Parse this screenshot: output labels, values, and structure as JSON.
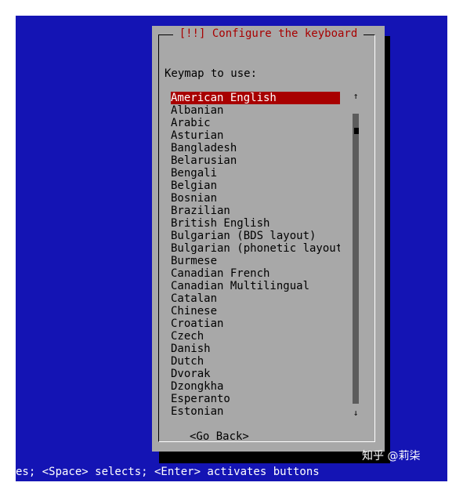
{
  "dialog": {
    "title": "[!!] Configure the keyboard",
    "prompt": "Keymap to use:",
    "selected_index": 0,
    "keymaps": [
      "American English",
      "Albanian",
      "Arabic",
      "Asturian",
      "Bangladesh",
      "Belarusian",
      "Bengali",
      "Belgian",
      "Bosnian",
      "Brazilian",
      "British English",
      "Bulgarian (BDS layout)",
      "Bulgarian (phonetic layout)",
      "Burmese",
      "Canadian French",
      "Canadian Multilingual",
      "Catalan",
      "Chinese",
      "Croatian",
      "Czech",
      "Danish",
      "Dutch",
      "Dvorak",
      "Dzongkha",
      "Esperanto",
      "Estonian"
    ],
    "scroll_up_symbol": "↑",
    "scroll_down_symbol": "↓",
    "go_back_label": "<Go Back>"
  },
  "status_bar": {
    "text": "es; <Space> selects; <Enter> activates buttons"
  },
  "watermark": {
    "text": "知乎 @莉柒"
  },
  "colors": {
    "screen_background": "#1414b4",
    "dialog_background": "#a8a8a8",
    "accent": "#a80000",
    "selection_text": "#ffffff"
  }
}
